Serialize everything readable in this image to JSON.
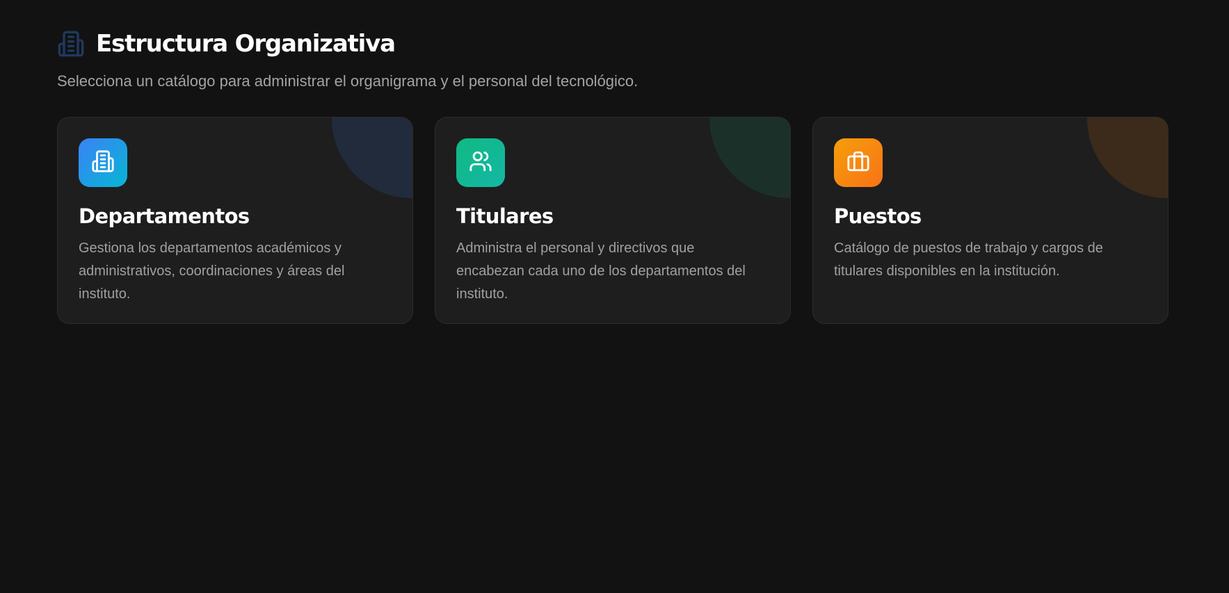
{
  "header": {
    "title": "Estructura Organizativa",
    "subtitle": "Selecciona un catálogo para administrar el organigrama y el personal del tecnológico.",
    "icon": "building-icon"
  },
  "cards": [
    {
      "title": "Departamentos",
      "description": "Gestiona los departamentos académicos y administrativos, coordinaciones y áreas del instituto.",
      "icon": "building-icon",
      "accent_from": "#3b82f6",
      "accent_to": "#06b6d4"
    },
    {
      "title": "Titulares",
      "description": "Administra el personal y directivos que encabezan cada uno de los departamentos del instituto.",
      "icon": "users-icon",
      "accent_from": "#10b981",
      "accent_to": "#14b8a6"
    },
    {
      "title": "Puestos",
      "description": "Catálogo de puestos de trabajo y cargos de titulares disponibles en la institución.",
      "icon": "briefcase-icon",
      "accent_from": "#f59e0b",
      "accent_to": "#f97316"
    }
  ],
  "colors": {
    "background": "#121212",
    "card_background": "#1e1e1e",
    "title_icon": "#1e3a5f"
  }
}
